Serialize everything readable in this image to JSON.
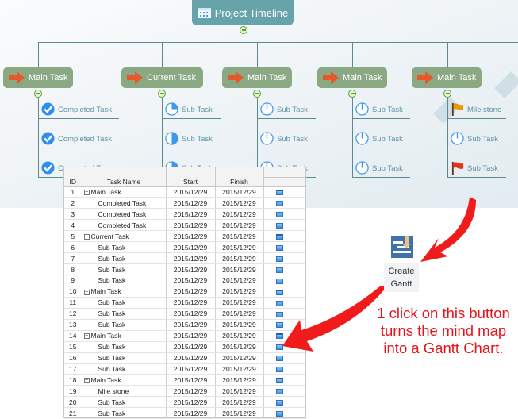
{
  "mindmap": {
    "root": "Project Timeline",
    "branches": [
      {
        "label": "Main Task",
        "items": [
          {
            "icon": "check",
            "label": "Completed Task"
          },
          {
            "icon": "check",
            "label": "Completed Task"
          },
          {
            "icon": "check",
            "label": "Completed Task"
          }
        ]
      },
      {
        "label": "Current Task",
        "items": [
          {
            "icon": "pie-25",
            "label": "Sub Task"
          },
          {
            "icon": "pie-50",
            "label": "Sub Task"
          },
          {
            "icon": "pie-50",
            "label": "Sub Task"
          }
        ]
      },
      {
        "label": "Main Task",
        "items": [
          {
            "icon": "pie-0",
            "label": "Sub Task"
          },
          {
            "icon": "pie-0",
            "label": "Sub Task"
          },
          {
            "icon": "pie-0",
            "label": "Sub Task"
          }
        ]
      },
      {
        "label": "Main Task",
        "items": [
          {
            "icon": "pie-0",
            "label": "Sub Task"
          },
          {
            "icon": "pie-0",
            "label": "Sub Task"
          },
          {
            "icon": "pie-0",
            "label": "Sub Task"
          }
        ]
      },
      {
        "label": "Main Task",
        "items": [
          {
            "icon": "flag-orange",
            "label": "Mile stone"
          },
          {
            "icon": "pie-0",
            "label": "Sub Task"
          },
          {
            "icon": "flag-red",
            "label": "Sub Task"
          }
        ]
      }
    ]
  },
  "gantt": {
    "headers": {
      "id": "ID",
      "name": "Task Name",
      "start": "Start",
      "finish": "Finish"
    },
    "rows": [
      {
        "id": "1",
        "name": "Main Task",
        "start": "2015/12/29",
        "finish": "2015/12/29",
        "summary": true
      },
      {
        "id": "2",
        "name": "Completed Task",
        "start": "2015/12/29",
        "finish": "2015/12/29"
      },
      {
        "id": "3",
        "name": "Completed Task",
        "start": "2015/12/29",
        "finish": "2015/12/29"
      },
      {
        "id": "4",
        "name": "Completed Task",
        "start": "2015/12/29",
        "finish": "2015/12/29"
      },
      {
        "id": "5",
        "name": "Current Task",
        "start": "2015/12/29",
        "finish": "2015/12/29",
        "summary": true
      },
      {
        "id": "6",
        "name": "Sub Task",
        "start": "2015/12/29",
        "finish": "2015/12/29"
      },
      {
        "id": "7",
        "name": "Sub Task",
        "start": "2015/12/29",
        "finish": "2015/12/29"
      },
      {
        "id": "8",
        "name": "Sub Task",
        "start": "2015/12/29",
        "finish": "2015/12/29"
      },
      {
        "id": "9",
        "name": "Sub Task",
        "start": "2015/12/29",
        "finish": "2015/12/29"
      },
      {
        "id": "10",
        "name": "Main Task",
        "start": "2015/12/29",
        "finish": "2015/12/29",
        "summary": true
      },
      {
        "id": "11",
        "name": "Sub Task",
        "start": "2015/12/29",
        "finish": "2015/12/29"
      },
      {
        "id": "12",
        "name": "Sub Task",
        "start": "2015/12/29",
        "finish": "2015/12/29"
      },
      {
        "id": "13",
        "name": "Sub Task",
        "start": "2015/12/29",
        "finish": "2015/12/29"
      },
      {
        "id": "14",
        "name": "Main Task",
        "start": "2015/12/29",
        "finish": "2015/12/29",
        "summary": true
      },
      {
        "id": "15",
        "name": "Sub Task",
        "start": "2015/12/29",
        "finish": "2015/12/29"
      },
      {
        "id": "16",
        "name": "Sub Task",
        "start": "2015/12/29",
        "finish": "2015/12/29"
      },
      {
        "id": "17",
        "name": "Sub Task",
        "start": "2015/12/29",
        "finish": "2015/12/29"
      },
      {
        "id": "18",
        "name": "Main Task",
        "start": "2015/12/29",
        "finish": "2015/12/29",
        "summary": true
      },
      {
        "id": "19",
        "name": "Mile stone",
        "start": "2015/12/29",
        "finish": "2015/12/29"
      },
      {
        "id": "20",
        "name": "Sub Task",
        "start": "2015/12/29",
        "finish": "2015/12/29"
      },
      {
        "id": "21",
        "name": "Sub Task",
        "start": "2015/12/29",
        "finish": "2015/12/29"
      }
    ]
  },
  "button": {
    "line1": "Create",
    "line2": "Gantt"
  },
  "note": {
    "line1": "1 click on this button",
    "line2": "turns the mind map",
    "line3": "into a Gantt Chart."
  },
  "colors": {
    "root": "#67a3ab",
    "node": "#8aa882",
    "accent": "#e8141b",
    "bar": "#3a8ee0"
  }
}
